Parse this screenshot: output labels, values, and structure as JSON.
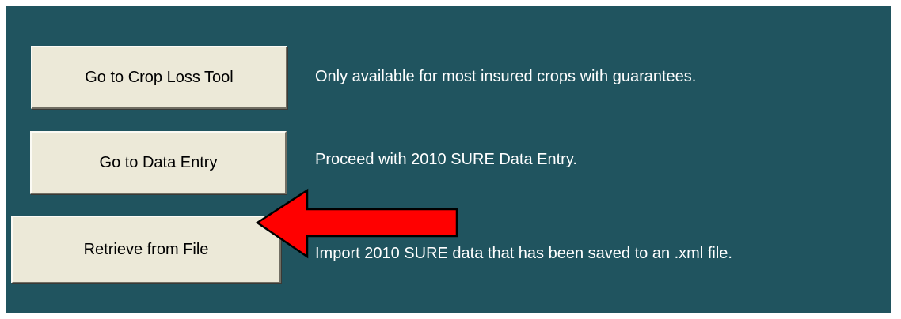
{
  "colors": {
    "background": "#20545f",
    "button_face": "#ece9d8",
    "description_text": "#ffffff",
    "arrow_fill": "#ff0000"
  },
  "buttons": {
    "crop_loss": {
      "label": "Go to Crop Loss Tool"
    },
    "data_entry": {
      "label": "Go to Data Entry"
    },
    "retrieve": {
      "label": "Retrieve from File"
    }
  },
  "descriptions": {
    "crop_loss": "Only available for most insured crops with guarantees.",
    "data_entry": "Proceed with 2010 SURE Data Entry.",
    "retrieve": "Import 2010 SURE data that has been saved to an .xml file."
  },
  "annotation": {
    "icon": "red-left-arrow-icon"
  }
}
